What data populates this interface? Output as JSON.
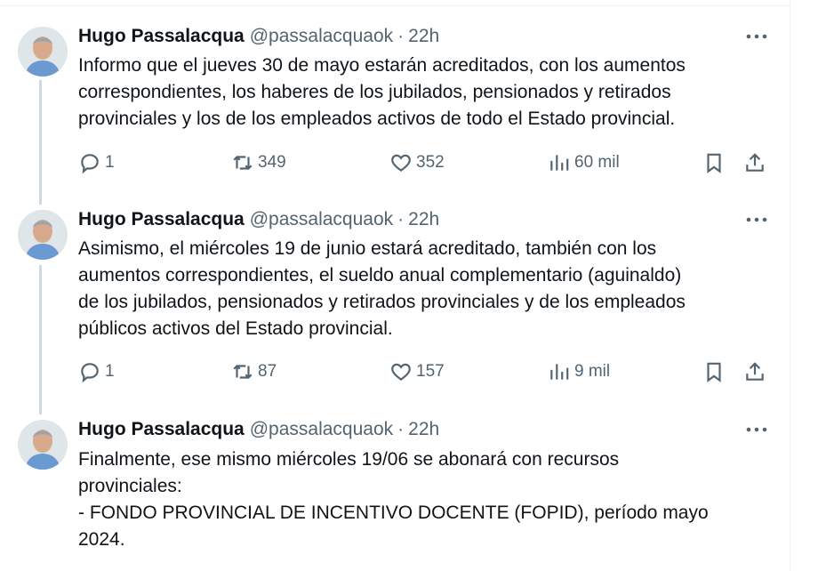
{
  "tweets": [
    {
      "author": "Hugo Passalacqua",
      "handle": "@passalacquaok",
      "separator": "·",
      "time": "22h",
      "text": "Informo que el jueves 30 de mayo estarán acreditados, con los aumentos\ncorrespondientes, los haberes de los jubilados, pensionados y retirados\nprovinciales y los de los empleados activos de todo el Estado provincial.",
      "replies": "1",
      "retweets": "349",
      "likes": "352",
      "views": "60 mil"
    },
    {
      "author": "Hugo Passalacqua",
      "handle": "@passalacquaok",
      "separator": "·",
      "time": "22h",
      "text": "Asimismo, el miércoles 19 de junio estará acreditado, también con los\naumentos correspondientes, el sueldo anual complementario (aguinaldo)\nde los jubilados, pensionados y retirados provinciales y de los empleados\npúblicos activos del Estado provincial.",
      "replies": "1",
      "retweets": "87",
      "likes": "157",
      "views": "9 mil"
    },
    {
      "author": "Hugo Passalacqua",
      "handle": "@passalacquaok",
      "separator": "·",
      "time": "22h",
      "text": "Finalmente, ese mismo miércoles 19/06 se abonará con recursos\nprovinciales:\n- FONDO PROVINCIAL DE INCENTIVO DOCENTE (FOPID), período mayo\n2024."
    }
  ],
  "icons": {
    "more": "more-horizontal-icon",
    "reply": "reply-icon",
    "retweet": "retweet-icon",
    "like": "heart-icon",
    "views": "views-icon",
    "bookmark": "bookmark-icon",
    "share": "share-icon"
  },
  "colors": {
    "text": "#0f1419",
    "secondary": "#536471",
    "thread_line": "#cfd9de",
    "border": "#eff3f4"
  }
}
